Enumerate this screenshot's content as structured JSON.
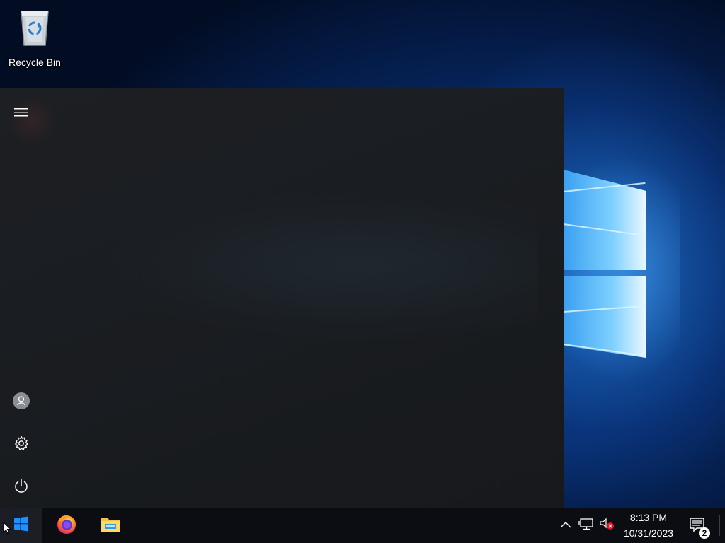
{
  "desktop": {
    "icons": [
      {
        "label": "Recycle Bin",
        "icon": "recycle-bin-icon"
      }
    ]
  },
  "start_menu": {
    "rail": [
      {
        "name": "expand",
        "icon": "hamburger-menu-icon"
      },
      {
        "name": "account",
        "icon": "user-account-icon"
      },
      {
        "name": "settings",
        "icon": "gear-icon"
      },
      {
        "name": "power",
        "icon": "power-icon"
      }
    ]
  },
  "taskbar": {
    "start_icon": "windows-logo-icon",
    "pinned": [
      {
        "app": "Firefox",
        "icon": "firefox-icon"
      },
      {
        "app": "File Explorer",
        "icon": "folder-icon"
      }
    ],
    "tray": {
      "icons": [
        "chevron-up-icon",
        "network-icon",
        "volume-muted-icon"
      ],
      "time": "8:13 PM",
      "date": "10/31/2023",
      "notification_count": "2"
    }
  },
  "colors": {
    "accent": "#1e90ff",
    "taskbar": "#0b0d12",
    "start_menu": "#1b1d21",
    "error_badge": "#e81123"
  }
}
